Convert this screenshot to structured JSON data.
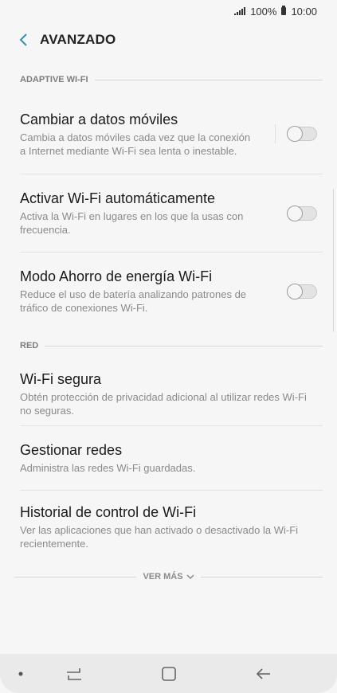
{
  "status_bar": {
    "battery_percent": "100%",
    "time": "10:00"
  },
  "header": {
    "title": "AVANZADO"
  },
  "sections": [
    {
      "header": "ADAPTIVE WI-FI",
      "items": [
        {
          "title": "Cambiar a datos móviles",
          "description": "Cambia a datos móviles cada vez que la conexión a Internet mediante Wi-Fi sea lenta o inestable.",
          "toggle": "off"
        },
        {
          "title": "Activar Wi-Fi automáticamente",
          "description": "Activa la Wi-Fi en lugares en los que la usas con frecuencia.",
          "toggle": "off"
        },
        {
          "title": "Modo Ahorro de energía Wi-Fi",
          "description": "Reduce el uso de batería analizando patrones de tráfico de conexiones Wi-Fi.",
          "toggle": "off"
        }
      ]
    },
    {
      "header": "RED",
      "items": [
        {
          "title": "Wi-Fi segura",
          "description": "Obtén protección de privacidad adicional al utilizar redes Wi-Fi no seguras."
        },
        {
          "title": "Gestionar redes",
          "description": "Administra las redes Wi-Fi guardadas."
        },
        {
          "title": "Historial de control de Wi-Fi",
          "description": "Ver las aplicaciones que han activado o desactivado la Wi-Fi recientemente."
        }
      ]
    }
  ],
  "see_more": {
    "label": "VER MÁS"
  },
  "icons": [
    "signal-icon",
    "battery-icon",
    "back-arrow-icon",
    "chevron-down-icon",
    "dot-icon",
    "recent-apps-icon",
    "home-icon",
    "back-nav-icon"
  ],
  "colors": {
    "accent": "#3a8fb0",
    "background": "#f6f6f6",
    "nav_bar": "#eaeaea"
  }
}
